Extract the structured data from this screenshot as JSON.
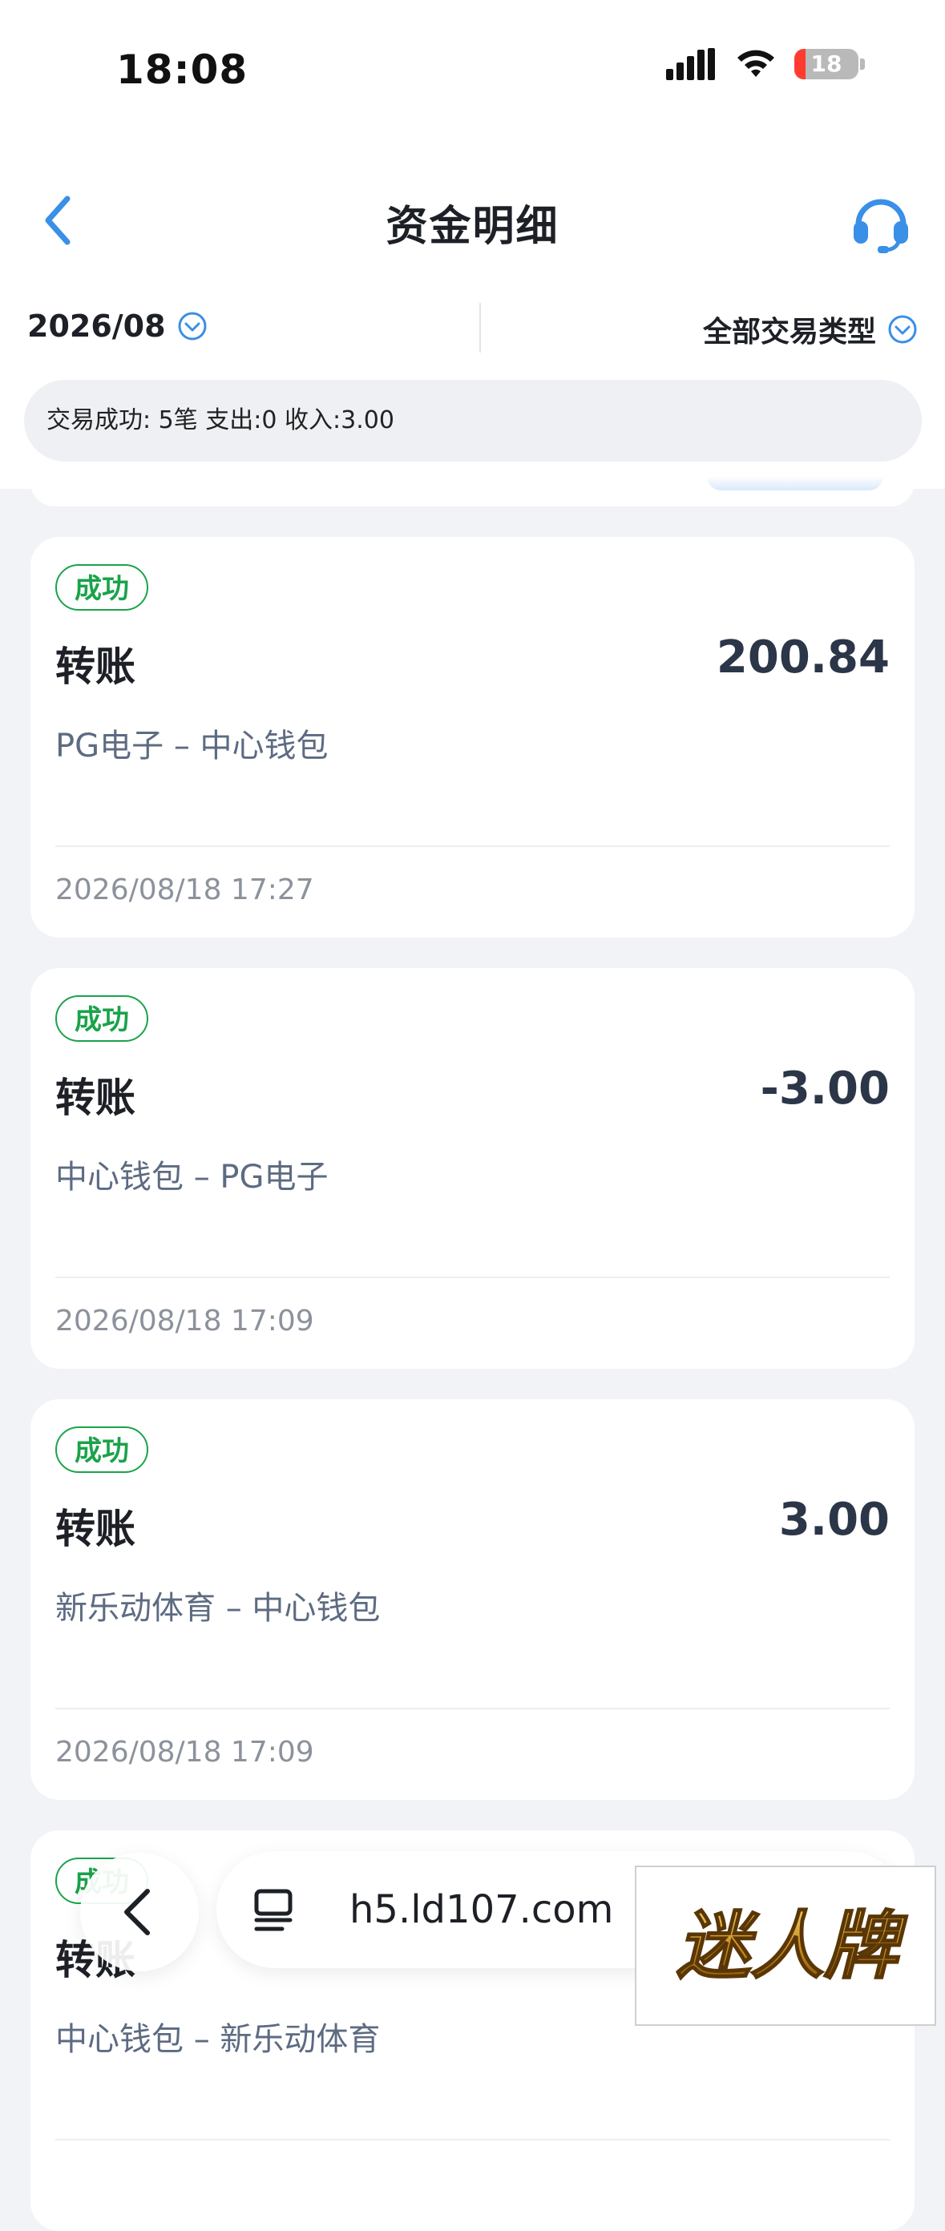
{
  "status_bar": {
    "time": "18:08",
    "battery": "18",
    "battery_fraction": 0.18
  },
  "nav": {
    "title": "资金明细",
    "back_icon": "chevron-left-icon",
    "support_icon": "headset-icon"
  },
  "filters": {
    "month": "2026/08",
    "type": "全部交易类型"
  },
  "summary": {
    "text": "交易成功: 5笔 支出:0 收入:3.00"
  },
  "transactions": [
    {
      "status": "成功",
      "title": "转账",
      "amount": "200.84",
      "desc": "PG电子 – 中心钱包",
      "time": "2026/08/18 17:27"
    },
    {
      "status": "成功",
      "title": "转账",
      "amount": "-3.00",
      "desc": "中心钱包 – PG电子",
      "time": "2026/08/18 17:09"
    },
    {
      "status": "成功",
      "title": "转账",
      "amount": "3.00",
      "desc": "新乐动体育 – 中心钱包",
      "time": "2026/08/18 17:09"
    },
    {
      "status": "成功",
      "title": "转账",
      "amount": "",
      "desc": "中心钱包 – 新乐动体育",
      "time": ""
    }
  ],
  "browser": {
    "url": "h5.ld107.com"
  },
  "watermark": {
    "text": "迷人牌"
  },
  "colors": {
    "success": "#1aa34a",
    "accent": "#3a8fe6",
    "amount": "#2b3648"
  }
}
